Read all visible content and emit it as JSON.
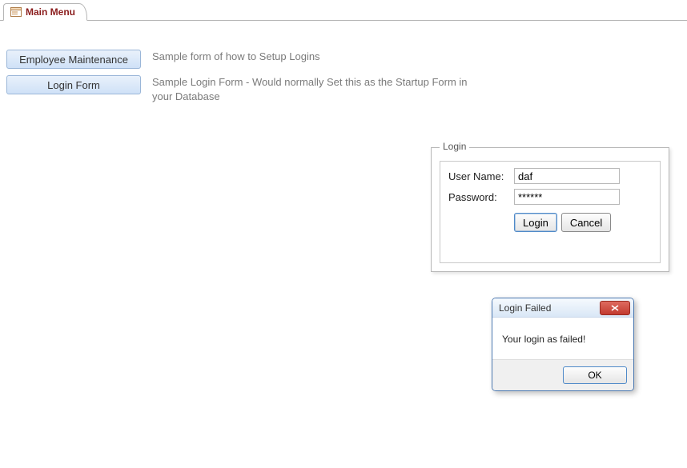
{
  "tab": {
    "title": "Main Menu"
  },
  "menu": {
    "employee_btn": "Employee Maintenance",
    "employee_desc": "Sample form of how to Setup Logins",
    "login_btn": "Login Form",
    "login_desc": "Sample Login Form - Would normally Set this as the Startup Form in your Database"
  },
  "login_dialog": {
    "legend": "Login",
    "username_label": "User Name:",
    "username_value": "daf",
    "password_label": "Password:",
    "password_value": "******",
    "login_btn": "Login",
    "cancel_btn": "Cancel"
  },
  "msgbox": {
    "title": "Login Failed",
    "body": "Your login as failed!",
    "ok_btn": "OK"
  }
}
